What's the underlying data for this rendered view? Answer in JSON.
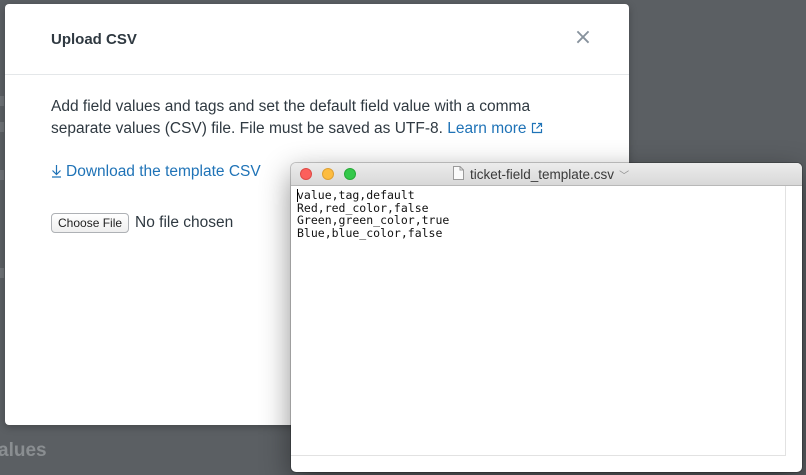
{
  "background": {
    "partial_heading": "alues"
  },
  "modal": {
    "title": "Upload CSV",
    "close_glyph": "×",
    "description": "Add field values and tags and set the default field value with a comma separate values (CSV) file. File must be saved as UTF-8.",
    "learn_more": "Learn more",
    "download_link": "Download the template CSV",
    "choose_file_label": "Choose File",
    "no_file_text": "No file chosen",
    "link_color": "#1f73b7"
  },
  "text_window": {
    "title": "ticket-field_template.csv",
    "lines": [
      "value,tag,default",
      "Red,red_color,false",
      "Green,green_color,true",
      "Blue,blue_color,false"
    ],
    "traffic_lights": {
      "close": "#fc605c",
      "minimize": "#fdbc40",
      "maximize": "#34c84a"
    }
  }
}
